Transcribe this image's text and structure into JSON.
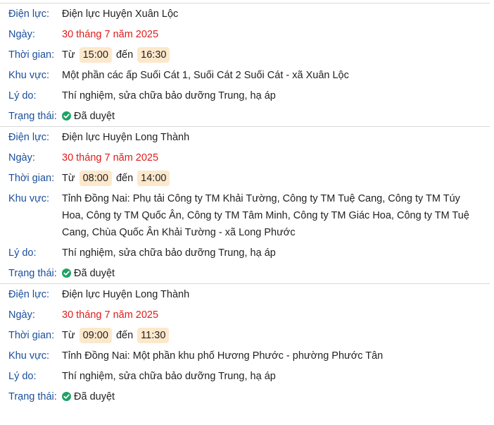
{
  "labels": {
    "unit": "Điện lực:",
    "date": "Ngày:",
    "time": "Thời gian:",
    "area": "Khu vực:",
    "reason": "Lý do:",
    "status": "Trạng thái:",
    "from": "Từ",
    "to": "đến"
  },
  "entries": [
    {
      "unit": "Điện lực Huyện Xuân Lộc",
      "date": "30 tháng 7 năm 2025",
      "start": "15:00",
      "end": "16:30",
      "area": "Một phần các ấp Suối Cát 1, Suối Cát 2 Suối Cát - xã Xuân Lộc",
      "reason": "Thí nghiệm, sửa chữa bảo dưỡng Trung, hạ áp",
      "status": "Đã duyệt"
    },
    {
      "unit": "Điện lực Huyện Long Thành",
      "date": "30 tháng 7 năm 2025",
      "start": "08:00",
      "end": "14:00",
      "area": "Tỉnh Đồng Nai: Phụ tải Công ty TM Khải Tường, Công ty TM Tuệ Cang, Công ty TM Túy Hoa, Công ty TM Quốc Ân, Công ty TM Tâm Minh, Công ty TM Giác Hoa, Công ty TM Tuệ Cang, Chùa Quốc Ân Khải Tường - xã Long Phước",
      "reason": "Thí nghiệm, sửa chữa bảo dưỡng Trung, hạ áp",
      "status": "Đã duyệt"
    },
    {
      "unit": "Điện lực Huyện Long Thành",
      "date": "30 tháng 7 năm 2025",
      "start": "09:00",
      "end": "11:30",
      "area": "Tỉnh Đồng Nai: Một phần khu phố Hương Phước - phường Phước Tân",
      "reason": "Thí nghiệm, sửa chữa bảo dưỡng Trung, hạ áp",
      "status": "Đã duyệt"
    }
  ]
}
